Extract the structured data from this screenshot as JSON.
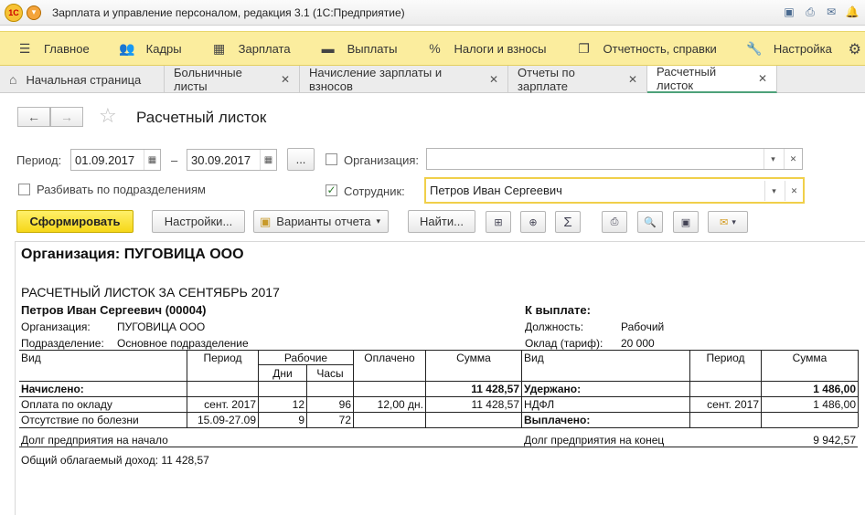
{
  "window": {
    "title": "Зарплата и управление персоналом, редакция 3.1 (1С:Предприятие)",
    "logo": "1С"
  },
  "sections": [
    {
      "icon": "menu-icon",
      "glyph": "☰",
      "label": "Главное"
    },
    {
      "icon": "people-icon",
      "glyph": "👥",
      "label": "Кадры"
    },
    {
      "icon": "calculator-icon",
      "glyph": "▦",
      "label": "Зарплата"
    },
    {
      "icon": "wallet-icon",
      "glyph": "▬",
      "label": "Выплаты"
    },
    {
      "icon": "percent-icon",
      "glyph": "%",
      "label": "Налоги и взносы"
    },
    {
      "icon": "reports-icon",
      "glyph": "❐",
      "label": "Отчетность, справки"
    },
    {
      "icon": "wrench-icon",
      "glyph": "🔧",
      "label": "Настройка"
    }
  ],
  "tabs": [
    {
      "label": "Начальная страница"
    },
    {
      "label": "Больничные листы"
    },
    {
      "label": "Начисление зарплаты и взносов"
    },
    {
      "label": "Отчеты по зарплате"
    },
    {
      "label": "Расчетный листок"
    }
  ],
  "form": {
    "title": "Расчетный листок",
    "period_label": "Период:",
    "period_from": "01.09.2017",
    "period_dash": "–",
    "period_to": "30.09.2017",
    "period_more": "...",
    "org_label": "Организация:",
    "org_value": "",
    "split_label": "Разбивать по подразделениям",
    "employee_label": "Сотрудник:",
    "employee_value": "Петров Иван Сергеевич",
    "employee_checked": true,
    "org_checked": false,
    "split_checked": false
  },
  "toolbar": {
    "generate": "Сформировать",
    "settings": "Настройки...",
    "variants": "Варианты отчета",
    "find": "Найти..."
  },
  "report": {
    "org_heading": "Организация: ПУГОВИЦА ООО",
    "sheet_title": "РАСЧЕТНЫЙ ЛИСТОК ЗА СЕНТЯБРЬ 2017",
    "employee": "Петров Иван Сергеевич (00004)",
    "to_pay": "К выплате:",
    "org_label": "Организация:",
    "org_value": "ПУГОВИЦА ООО",
    "dept_label": "Подразделение:",
    "dept_value": "Основное подразделение",
    "position_label": "Должность:",
    "position_value": "Рабочий",
    "salary_label": "Оклад (тариф):",
    "salary_value": "20 000",
    "headers": {
      "kind": "Вид",
      "period": "Период",
      "working": "Рабочие",
      "days": "Дни",
      "hours": "Часы",
      "paid": "Оплачено",
      "sum": "Сумма",
      "kind2": "Вид",
      "period2": "Период",
      "sum2": "Сумма"
    },
    "accrued_label": "Начислено:",
    "accrued_total": "11 428,57",
    "withheld_label": "Удержано:",
    "withheld_total": "1 486,00",
    "paid_out_label": "Выплачено:",
    "rows": [
      {
        "kind": "Оплата по окладу",
        "period": "сент. 2017",
        "days": "12",
        "hours": "96",
        "paid": "12,00 дн.",
        "sum": "11 428,57"
      },
      {
        "kind": "Отсутствие по болезни",
        "period": "15.09-27.09",
        "days": "9",
        "hours": "72",
        "paid": "",
        "sum": ""
      }
    ],
    "deductions": [
      {
        "kind": "НДФЛ",
        "period": "сент. 2017",
        "sum": "1 486,00"
      }
    ],
    "debt_start_label": "Долг предприятия на начало",
    "debt_end_label": "Долг предприятия на конец",
    "debt_end_value": "9 942,57",
    "taxable_income": "Общий облагаемый доход: 11 428,57"
  }
}
